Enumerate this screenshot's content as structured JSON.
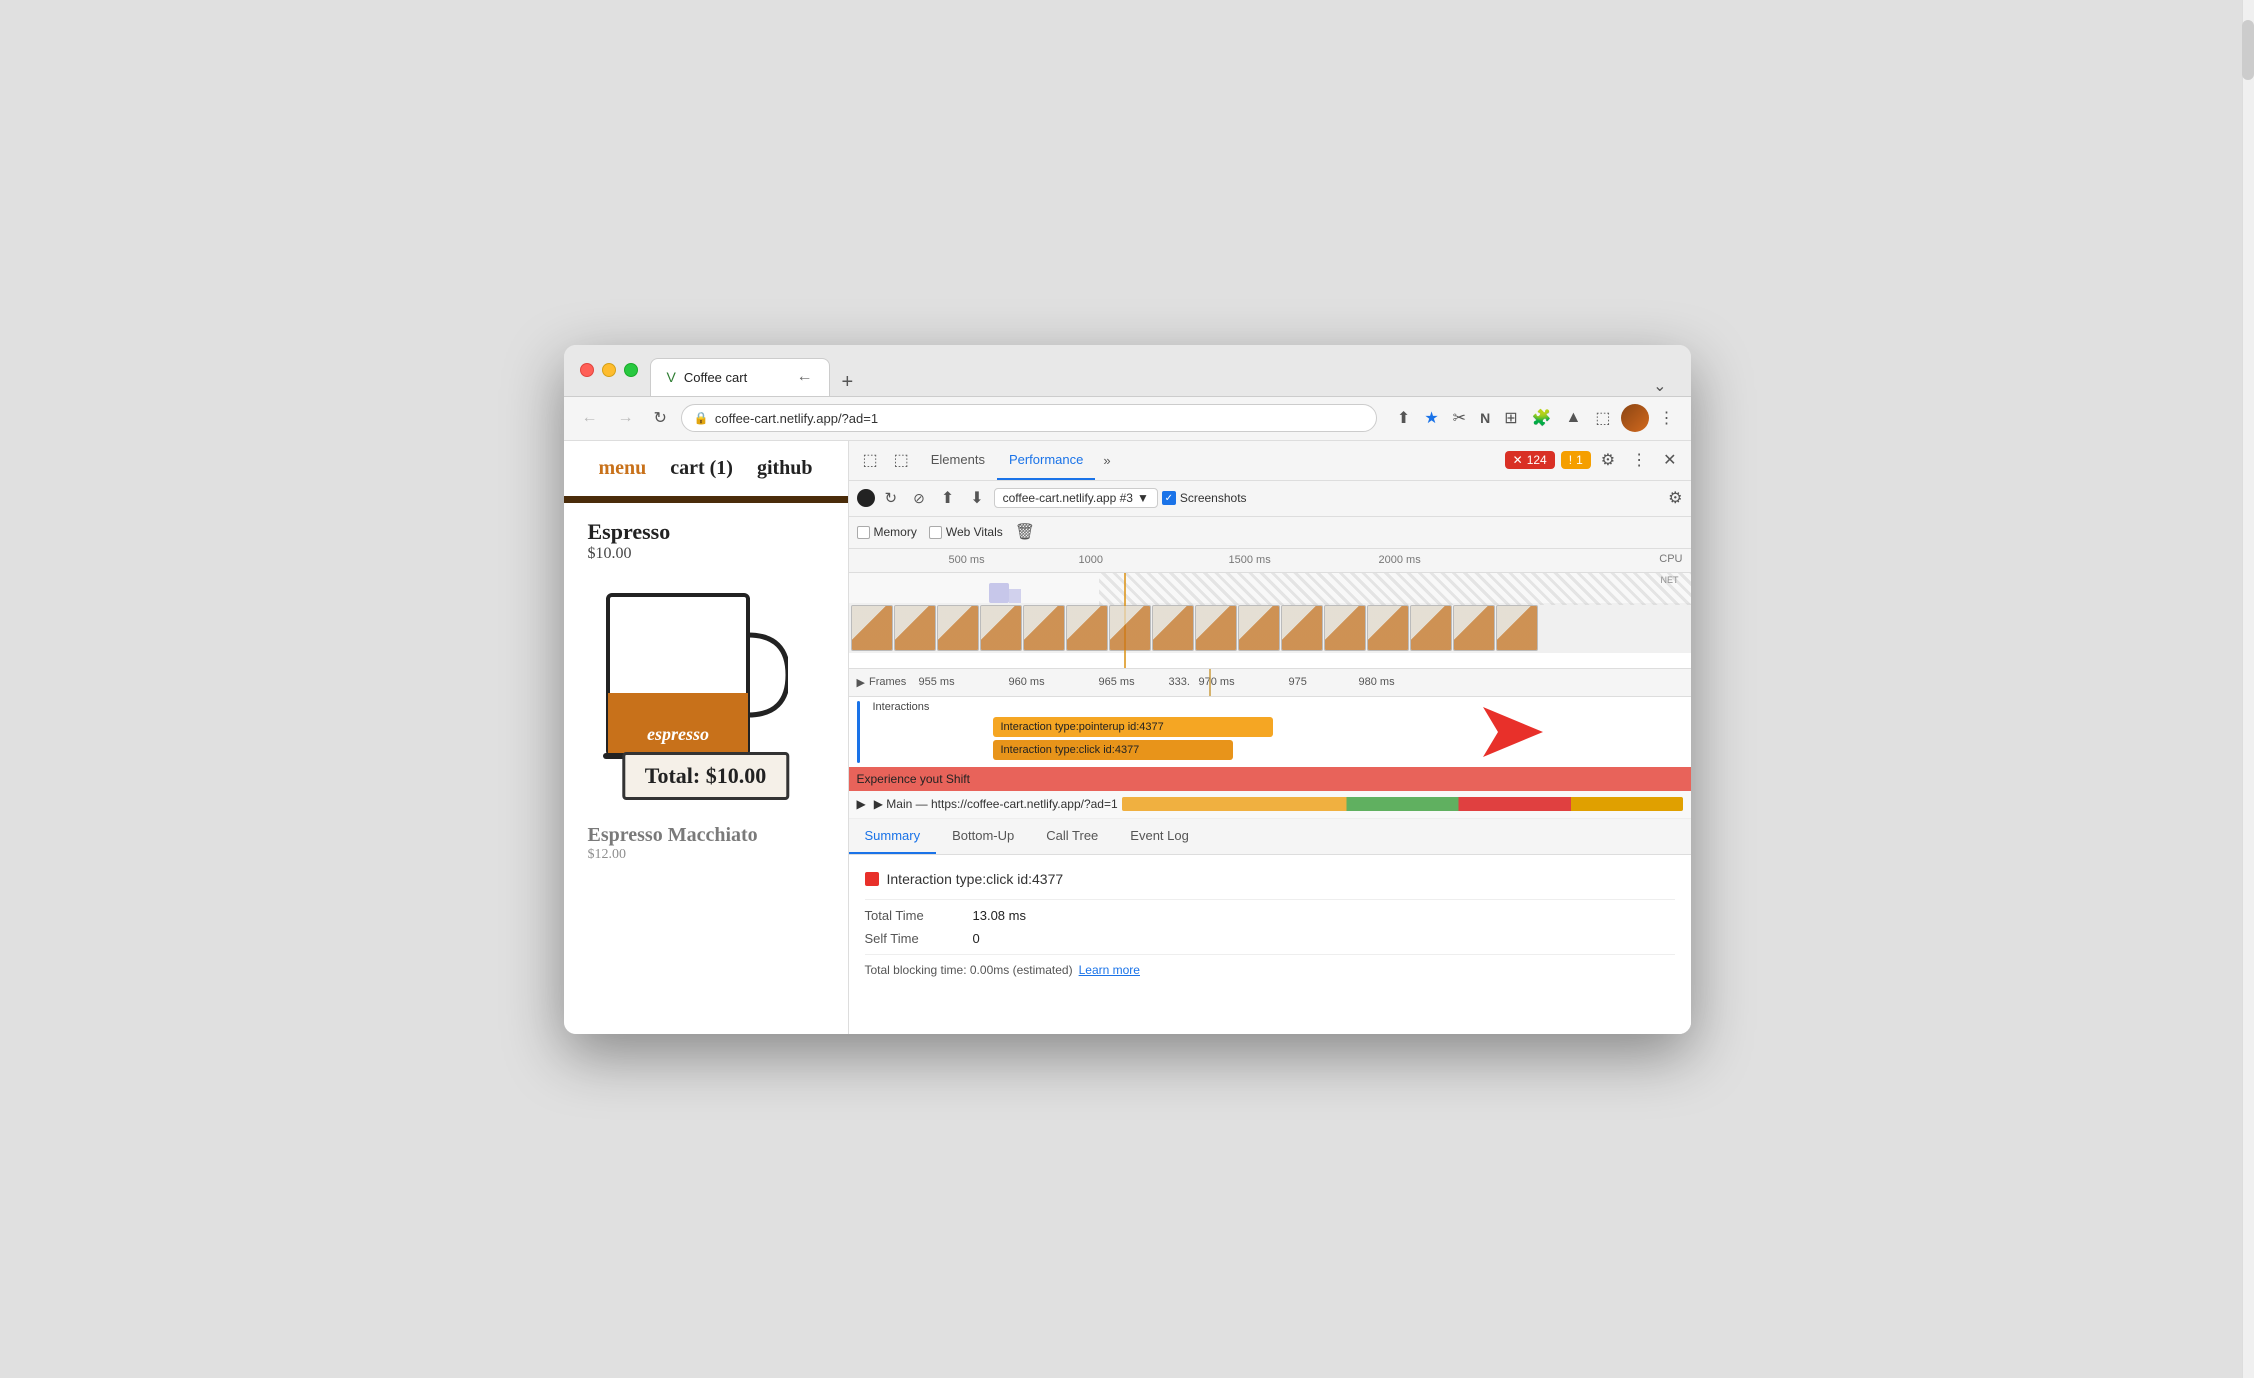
{
  "window": {
    "title": "Coffee cart",
    "url": "coffee-cart.netlify.app/?ad=1"
  },
  "browser": {
    "tab_favicon": "V",
    "tab_title": "Coffee cart",
    "new_tab": "+",
    "chevron": "⌄",
    "nav_back": "←",
    "nav_forward": "→",
    "nav_reload": "↻"
  },
  "toolbar_icons": {
    "share": "⬆",
    "star": "★",
    "scissors": "✂",
    "notion": "N",
    "extensions_grid": "⊞",
    "puzzle": "🧩",
    "account": "▲",
    "layout": "⬚",
    "more_vert": "⋮"
  },
  "website": {
    "nav_menu": "menu",
    "nav_cart": "cart (1)",
    "nav_github": "github",
    "separator": "",
    "item1_name": "Espresso",
    "item1_price": "$10.00",
    "cup_label": "espresso",
    "total_label": "Total: $10.00",
    "item2_name": "Espresso Macchiato",
    "item2_price": "$12.00"
  },
  "devtools": {
    "tab_elements": "Elements",
    "tab_performance": "Performance",
    "tab_more": "»",
    "badge_error_icon": "✕",
    "badge_error_count": "124",
    "badge_warning_icon": "!",
    "badge_warning_count": "1",
    "gear_icon": "⚙",
    "more_vert_icon": "⋮",
    "close_icon": "✕",
    "cursor_icon": "⬚",
    "inspect_icon": "⬚",
    "record_stop_icon": "⬤",
    "session_label": "coffee-cart.netlify.app #3",
    "upload_icon": "⬆",
    "download_icon": "⬇",
    "memory_label": "Memory",
    "web_vitals_label": "Web Vitals",
    "trash_icon": "🗑",
    "screenshots_label": "Screenshots",
    "settings_icon": "⚙",
    "timeline": {
      "marks": [
        "500 ms",
        "1000",
        "1500 ms",
        "2000 ms"
      ],
      "mark_positions": [
        100,
        230,
        380,
        530
      ],
      "cpu_label": "CPU",
      "net_label": "NET"
    },
    "frames_times": [
      "955 ms",
      "960 ms",
      "965 ms",
      "333.",
      "970 ms",
      "975",
      "980 ms"
    ],
    "frames_label": "▶ Frames",
    "interactions_label": "Interactions",
    "interaction1": "Interaction type:pointerup id:4377",
    "interaction2": "Interaction type:click id:4377",
    "experience_shift": "Experience yout Shift",
    "main_thread_label": "▶ Main — https://coffee-cart.netlify.app/?ad=1",
    "summary_tabs": [
      "Summary",
      "Bottom-Up",
      "Call Tree",
      "Event Log"
    ],
    "summary_interaction_label": "Interaction type:click id:4377",
    "total_time_label": "Total Time",
    "total_time_value": "13.08 ms",
    "self_time_label": "Self Time",
    "self_time_value": "0",
    "total_blocking_label": "Total blocking time: 0.00ms (estimated)",
    "learn_more_label": "Learn more"
  }
}
